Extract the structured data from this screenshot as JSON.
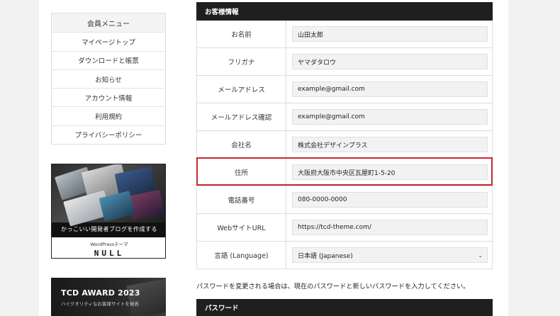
{
  "sidebar": {
    "title": "会員メニュー",
    "items": [
      {
        "label": "マイページトップ"
      },
      {
        "label": "ダウンロードと帳票"
      },
      {
        "label": "お知らせ"
      },
      {
        "label": "アカウント情報"
      },
      {
        "label": "利用規約"
      },
      {
        "label": "プライバシーポリシー"
      }
    ]
  },
  "banner1": {
    "tagline": "かっこいい開発者ブログを作成する",
    "subtitle": "WordPressテーマ",
    "name": "NULL"
  },
  "banner2": {
    "title": "TCD AWARD 2023",
    "subtitle": "ハイクオリティなお客様サイトを発表"
  },
  "customer_section": {
    "title": "お客様情報",
    "rows": [
      {
        "label": "お名前",
        "value": "山田太郎"
      },
      {
        "label": "フリガナ",
        "value": "ヤマダタロウ"
      },
      {
        "label": "メールアドレス",
        "value": "example@gmail.com"
      },
      {
        "label": "メールアドレス確認",
        "value": "example@gmail.com"
      },
      {
        "label": "会社名",
        "value": "株式会社デザインプラス"
      },
      {
        "label": "住所",
        "value": "大阪府大阪市中央区瓦屋町1-5-20"
      },
      {
        "label": "電話番号",
        "value": "080-0000-0000"
      },
      {
        "label": "WebサイトURL",
        "value": "https://tcd-theme.com/"
      }
    ],
    "language": {
      "label": "言語 (Language)",
      "value": "日本語 (Japanese)"
    }
  },
  "password_note": "パスワードを変更される場合は、現在のパスワードと新しいパスワードを入力してください。",
  "password_section": {
    "title": "パスワード"
  },
  "colors": {
    "highlight": "#c8282d",
    "header_bg": "#1f1f1f"
  }
}
